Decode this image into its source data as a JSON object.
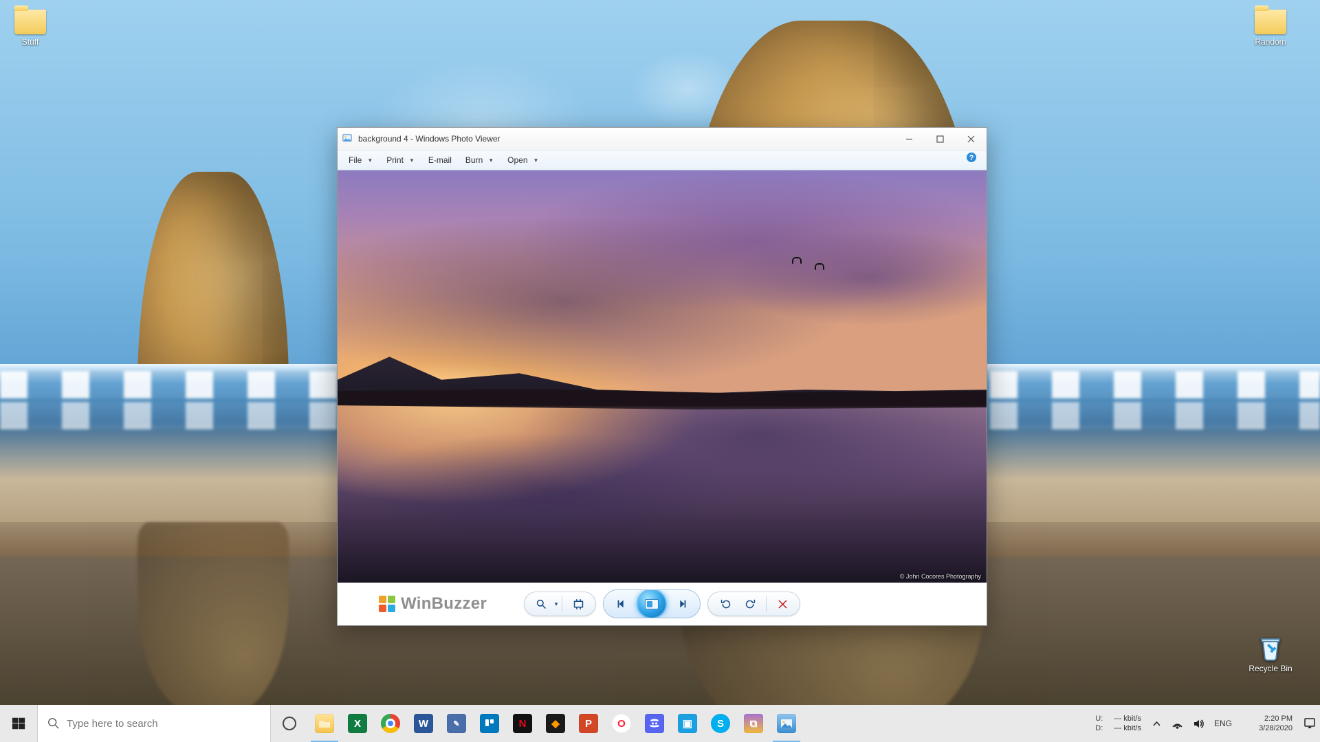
{
  "desktop_icons": {
    "stuff": "Stuff",
    "random": "Random",
    "recycle_bin": "Recycle Bin"
  },
  "taskbar": {
    "search_placeholder": "Type here to search",
    "net_up_label": "U:",
    "net_dn_label": "D:",
    "net_up_value": "--- kbit/s",
    "net_dn_value": "--- kbit/s",
    "language": "ENG",
    "time": "2:20 PM",
    "date": "3/28/2020"
  },
  "photo_viewer": {
    "title": "background 4 - Windows Photo Viewer",
    "menu": {
      "file": "File",
      "print": "Print",
      "email": "E-mail",
      "burn": "Burn",
      "open": "Open"
    },
    "credit": "© John Cocores Photography",
    "watermark": "WinBuzzer",
    "zoom_dropdown_hint": "▾"
  }
}
